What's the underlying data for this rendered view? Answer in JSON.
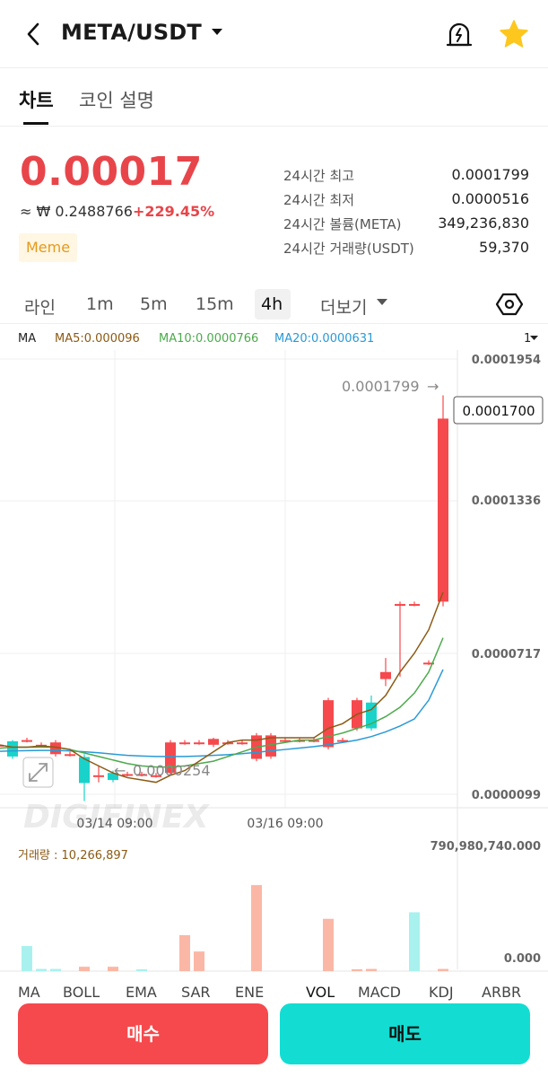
{
  "header": {
    "pair": "META/USDT"
  },
  "tabs": [
    {
      "label": "차트",
      "active": true
    },
    {
      "label": "코인 설명",
      "active": false
    }
  ],
  "ticker": {
    "price": "0.00017",
    "krw": "≈ ₩ 0.2488766",
    "change": "+229.45%",
    "tag": "Meme",
    "stats": [
      {
        "label": "24시간 최고",
        "value": "0.0001799"
      },
      {
        "label": "24시간 최저",
        "value": "0.0000516"
      },
      {
        "label": "24시간 볼륨(META)",
        "value": "349,236,830"
      },
      {
        "label": "24시간 거래량(USDT)",
        "value": "59,370"
      }
    ]
  },
  "intervals": {
    "items": [
      "라인",
      "1m",
      "5m",
      "15m",
      "4h"
    ],
    "active": "4h",
    "more": "더보기"
  },
  "ma": {
    "label": "MA",
    "ma5": "MA5:0.000096",
    "ma10": "MA10:0.0000766",
    "ma20": "MA20:0.0000631",
    "scale": "1"
  },
  "colors": {
    "up": "#f6494d",
    "down": "#19d3cb",
    "ma5": "#8b5a14",
    "ma10": "#4caa4c",
    "ma20": "#2a9ad6"
  },
  "chart_data": {
    "type": "candlestick",
    "y_ticks": [
      "0.0001954",
      "0.0001336",
      "0.0000717",
      "0.0000099"
    ],
    "ylim": [
      9.9e-06,
      0.0001954
    ],
    "x_ticks": [
      "03/14 09:00",
      "03/16 09:00"
    ],
    "current_price": "0.0001700",
    "high_label": "0.0001799",
    "low_label": "0.0000254",
    "candles": [
      {
        "o": 2.99e-05,
        "c": 2.99e-05,
        "h": 3.1e-05,
        "l": 2.4e-05
      },
      {
        "o": 3.1e-05,
        "c": 3.1e-05,
        "h": 3.2e-05,
        "l": 3e-05
      },
      {
        "o": 3.1e-05,
        "c": 3.1e-05,
        "h": 3.2e-05,
        "l": 3e-05
      },
      {
        "o": 3.25e-05,
        "c": 2.6e-05,
        "h": 3.3e-05,
        "l": 2.5e-05
      },
      {
        "o": 3.3e-05,
        "c": 3.3e-05,
        "h": 3.4e-05,
        "l": 3.2e-05
      },
      {
        "o": 3.1e-05,
        "c": 3.1e-05,
        "h": 3.2e-05,
        "l": 3e-05
      },
      {
        "o": 2.7e-05,
        "c": 3.2e-05,
        "h": 3.3e-05,
        "l": 2.6e-05
      },
      {
        "o": 2.7e-05,
        "c": 2.7e-05,
        "h": 2.8e-05,
        "l": 2.6e-05
      },
      {
        "o": 2.58e-05,
        "c": 1.47e-05,
        "h": 2.7e-05,
        "l": 7e-06
      },
      {
        "o": 1.8e-05,
        "c": 1.8e-05,
        "h": 2.2e-05,
        "l": 1.5e-05
      },
      {
        "o": 1.9e-05,
        "c": 1.6e-05,
        "h": 2e-05,
        "l": 1.5e-05
      },
      {
        "o": 1.85e-05,
        "c": 1.85e-05,
        "h": 1.95e-05,
        "l": 1.75e-05
      },
      {
        "o": 1.85e-05,
        "c": 1.85e-05,
        "h": 1.95e-05,
        "l": 1.75e-05
      },
      {
        "o": 1.8e-05,
        "c": 1.8e-05,
        "h": 1.9e-05,
        "l": 1.7e-05
      },
      {
        "o": 1.9e-05,
        "c": 3.2e-05,
        "h": 3.3e-05,
        "l": 1.8e-05
      },
      {
        "o": 3.2e-05,
        "c": 3.2e-05,
        "h": 3.3e-05,
        "l": 3.1e-05
      },
      {
        "o": 3.2e-05,
        "c": 3.2e-05,
        "h": 3.3e-05,
        "l": 3.1e-05
      },
      {
        "o": 3.1e-05,
        "c": 3.35e-05,
        "h": 3.4e-05,
        "l": 3e-05
      },
      {
        "o": 3.2e-05,
        "c": 3.2e-05,
        "h": 3.3e-05,
        "l": 3.1e-05
      },
      {
        "o": 3.2e-05,
        "c": 3.2e-05,
        "h": 3.3e-05,
        "l": 3.1e-05
      },
      {
        "o": 2.5e-05,
        "c": 3.5e-05,
        "h": 3.6e-05,
        "l": 2.4e-05
      },
      {
        "o": 2.6e-05,
        "c": 3.5e-05,
        "h": 3.6e-05,
        "l": 2.5e-05
      },
      {
        "o": 3.3e-05,
        "c": 3.3e-05,
        "h": 3.4e-05,
        "l": 3.2e-05
      },
      {
        "o": 3.3e-05,
        "c": 3.3e-05,
        "h": 3.4e-05,
        "l": 3.2e-05
      },
      {
        "o": 3.3e-05,
        "c": 3.3e-05,
        "h": 3.4e-05,
        "l": 3.2e-05
      },
      {
        "o": 3e-05,
        "c": 5e-05,
        "h": 5.1e-05,
        "l": 2.9e-05
      },
      {
        "o": 3.3e-05,
        "c": 3.3e-05,
        "h": 3.4e-05,
        "l": 3.2e-05
      },
      {
        "o": 3.8e-05,
        "c": 5e-05,
        "h": 5.1e-05,
        "l": 3.7e-05
      },
      {
        "o": 4.9e-05,
        "c": 3.8e-05,
        "h": 5.2e-05,
        "l": 3.7e-05
      },
      {
        "o": 5.9e-05,
        "c": 6.2e-05,
        "h": 6.8e-05,
        "l": 5.6e-05
      },
      {
        "o": 9.1e-05,
        "c": 9.1e-05,
        "h": 9.2e-05,
        "l": 6e-05
      },
      {
        "o": 9.1e-05,
        "c": 9.1e-05,
        "h": 9.2e-05,
        "l": 9e-05
      },
      {
        "o": 6.6e-05,
        "c": 6.6e-05,
        "h": 6.7e-05,
        "l": 6.5e-05
      },
      {
        "o": 9.2e-05,
        "c": 0.00017,
        "h": 0.0001799,
        "l": 9e-05
      }
    ],
    "ma5": [
      3e-05,
      3.05e-05,
      3.1e-05,
      3e-05,
      3e-05,
      3.05e-05,
      3e-05,
      2.9e-05,
      2.5e-05,
      2.2e-05,
      1.9e-05,
      1.7e-05,
      1.6e-05,
      1.5e-05,
      1.8e-05,
      2e-05,
      2.4e-05,
      2.8e-05,
      3.2e-05,
      3.3e-05,
      3.3e-05,
      3.4e-05,
      3.4e-05,
      3.4e-05,
      3.4e-05,
      3.8e-05,
      4e-05,
      4.4e-05,
      4.6e-05,
      5.2e-05,
      6.2e-05,
      7e-05,
      8e-05,
      9.6e-05
    ],
    "ma10": [
      2.85e-05,
      2.9e-05,
      2.95e-05,
      3e-05,
      3e-05,
      3e-05,
      3e-05,
      2.9e-05,
      2.75e-05,
      2.6e-05,
      2.45e-05,
      2.3e-05,
      2.2e-05,
      2.15e-05,
      2.15e-05,
      2.2e-05,
      2.3e-05,
      2.4e-05,
      2.6e-05,
      2.8e-05,
      3e-05,
      3.1e-05,
      3.2e-05,
      3.3e-05,
      3.3e-05,
      3.45e-05,
      3.6e-05,
      3.8e-05,
      4e-05,
      4.3e-05,
      4.7e-05,
      5.3e-05,
      6.2e-05,
      7.66e-05
    ],
    "ma20": [
      2.8e-05,
      2.8e-05,
      2.82e-05,
      2.84e-05,
      2.85e-05,
      2.86e-05,
      2.86e-05,
      2.84e-05,
      2.8e-05,
      2.76e-05,
      2.7e-05,
      2.65e-05,
      2.62e-05,
      2.6e-05,
      2.6e-05,
      2.6e-05,
      2.62e-05,
      2.65e-05,
      2.68e-05,
      2.72e-05,
      2.78e-05,
      2.84e-05,
      2.9e-05,
      2.96e-05,
      3.02e-05,
      3.1e-05,
      3.2e-05,
      3.3e-05,
      3.45e-05,
      3.65e-05,
      3.9e-05,
      4.2e-05,
      5e-05,
      6.31e-05
    ],
    "volume": {
      "label": "거래량 : 10,266,897",
      "max_label": "790,980,740.000",
      "min_label": "0.000",
      "max": 790980740,
      "values": [
        0,
        0,
        6000000,
        0,
        0,
        0,
        0,
        0,
        230000000,
        20000000,
        20000000,
        0,
        40000000,
        0,
        40000000,
        0,
        10000000,
        0,
        0,
        330000000,
        180000000,
        0,
        0,
        0,
        790000000,
        0,
        0,
        0,
        0,
        480000000,
        0,
        10000000,
        20000000,
        0,
        0,
        540000000,
        0,
        20000000
      ],
      "up": [
        false,
        false,
        true,
        false,
        false,
        false,
        false,
        false,
        false,
        false,
        false,
        false,
        true,
        false,
        true,
        false,
        false,
        false,
        false,
        true,
        true,
        false,
        false,
        false,
        true,
        false,
        false,
        false,
        false,
        true,
        false,
        true,
        true,
        false,
        false,
        false,
        false,
        true
      ]
    }
  },
  "indicators": [
    "MA",
    "BOLL",
    "EMA",
    "SAR",
    "ENE",
    "VOL",
    "MACD",
    "KDJ",
    "ARBR"
  ],
  "actions": {
    "buy": "매수",
    "sell": "매도"
  }
}
